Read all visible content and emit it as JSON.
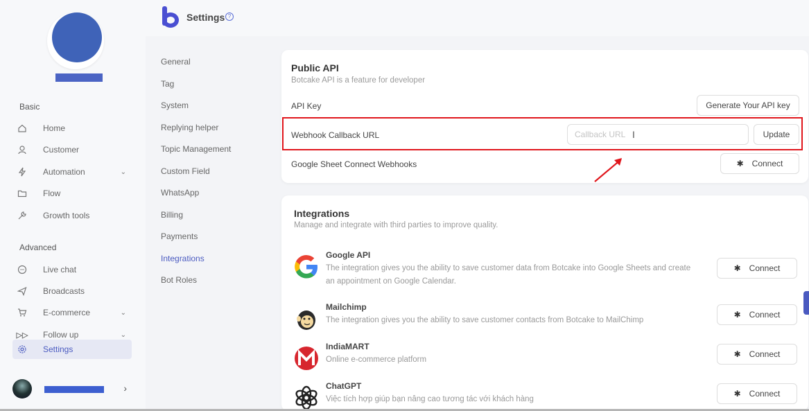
{
  "app": {
    "title": "Settings"
  },
  "sidebar": {
    "sections": [
      {
        "label": "Basic",
        "items": [
          {
            "label": "Home",
            "icon": "home-icon"
          },
          {
            "label": "Customer",
            "icon": "user-icon"
          },
          {
            "label": "Automation",
            "icon": "bolt-icon",
            "has_chevron": true
          },
          {
            "label": "Flow",
            "icon": "folder-icon"
          },
          {
            "label": "Growth tools",
            "icon": "wrench-icon"
          }
        ]
      },
      {
        "label": "Advanced",
        "items": [
          {
            "label": "Live chat",
            "icon": "chat-icon"
          },
          {
            "label": "Broadcasts",
            "icon": "send-icon"
          },
          {
            "label": "E-commerce",
            "icon": "cart-icon",
            "has_chevron": true
          },
          {
            "label": "Follow up",
            "icon": "follow-up-icon",
            "has_chevron": true
          },
          {
            "label": "Settings",
            "icon": "gear-icon",
            "active": true
          }
        ]
      }
    ]
  },
  "settings_menu": {
    "items": [
      "General",
      "Tag",
      "System",
      "Replying helper",
      "Topic Management",
      "Custom Field",
      "WhatsApp",
      "Billing",
      "Payments",
      "Integrations",
      "Bot Roles"
    ],
    "active": "Integrations"
  },
  "public_api": {
    "title": "Public API",
    "subtitle": "Botcake API is a feature for developer",
    "api_key_label": "API Key",
    "generate_button": "Generate Your API key",
    "webhook_label": "Webhook Callback URL",
    "webhook_placeholder": "Callback URL",
    "update_button": "Update",
    "gsheet_label": "Google Sheet Connect Webhooks",
    "connect_button": "Connect"
  },
  "integrations": {
    "title": "Integrations",
    "subtitle": "Manage and integrate with third parties to improve quality.",
    "items": [
      {
        "name": "Google API",
        "desc": "The integration gives you the ability to save customer data from Botcake into Google Sheets and create an appointment on Google Calendar.",
        "button": "Connect",
        "icon": "google-icon"
      },
      {
        "name": "Mailchimp",
        "desc": "The integration gives you the ability to save customer contacts from Botcake to MailChimp",
        "button": "Connect",
        "icon": "mailchimp-icon"
      },
      {
        "name": "IndiaMART",
        "desc": "Online e-commerce platform",
        "button": "Connect",
        "icon": "indiamart-icon"
      },
      {
        "name": "ChatGPT",
        "desc": "Việc tích hợp giúp bạn nâng cao tương tác với khách hàng",
        "button": "Connect",
        "icon": "chatgpt-icon"
      }
    ]
  },
  "colors": {
    "accent": "#4a5ac0",
    "highlight": "#e0161c",
    "logo": "#4a4fd2"
  }
}
